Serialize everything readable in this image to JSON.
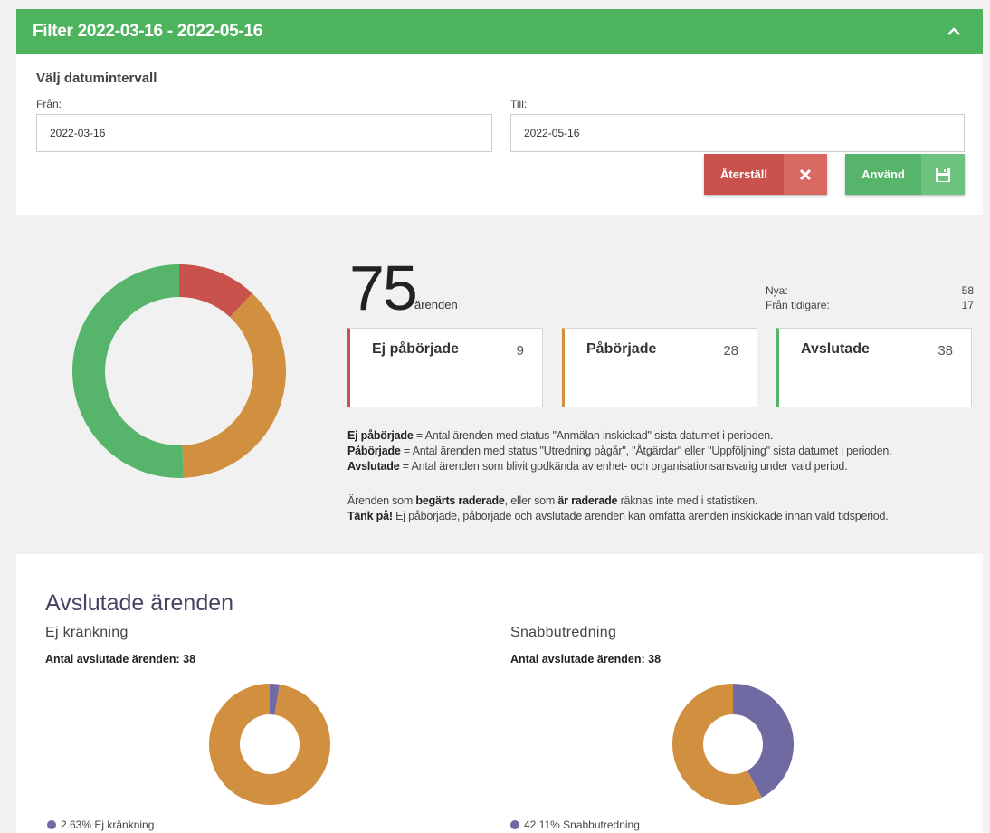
{
  "filter": {
    "title": "Filter 2022-03-16 - 2022-05-16",
    "collapse_icon": "chevron-up-icon",
    "section_label": "Välj datumintervall",
    "from_label": "Från:",
    "from_value": "2022-03-16",
    "to_label": "Till:",
    "to_value": "2022-05-16",
    "reset_label": "Återställ",
    "reset_icon": "close-icon",
    "apply_label": "Använd",
    "apply_icon": "save-icon",
    "header_color": "#4db35f"
  },
  "overview": {
    "total": "75",
    "total_unit": "ärenden",
    "new_label": "Nya:",
    "new_value": "58",
    "previous_label": "Från tidigare:",
    "previous_value": "17",
    "cards": [
      {
        "label": "Ej påbörjade",
        "value": "9",
        "color": "#c9524c"
      },
      {
        "label": "Påbörjade",
        "value": "28",
        "color": "#d1903f"
      },
      {
        "label": "Avslutade",
        "value": "38",
        "color": "#56b56a"
      }
    ],
    "legend": {
      "line1_bold": "Ej påbörjade",
      "line1_rest": " = Antal ärenden med status \"Anmälan inskickad\" sista datumet i perioden.",
      "line2_bold": "Påbörjade",
      "line2_rest": " = Antal ärenden med status \"Utredning pågår\", \"Åtgärdar\" eller \"Uppföljning\" sista datumet i perioden.",
      "line3_bold": "Avslutade",
      "line3_rest": " = Antal ärenden som blivit godkända av enhet- och organisationsansvarig under vald period.",
      "note1_a": "Ärenden som ",
      "note1_b": "begärts raderade",
      "note1_c": ", eller som ",
      "note1_d": "är raderade",
      "note1_e": " räknas inte med i statistiken.",
      "note2_bold": "Tänk på!",
      "note2_rest": " Ej påbörjade, påbörjade och avslutade ärenden kan omfatta ärenden inskickade innan vald tidsperiod."
    }
  },
  "closed": {
    "title": "Avslutade ärenden",
    "charts": [
      {
        "subtitle": "Ej kränkning",
        "count_text": "Antal avslutade ärenden: 38",
        "legend_text": "2.63% Ej kränkning"
      },
      {
        "subtitle": "Snabbutredning",
        "count_text": "Antal avslutade ärenden: 38",
        "legend_text": "42.11% Snabbutredning"
      }
    ]
  },
  "chart_data": [
    {
      "type": "pie",
      "categories": [
        "Ej påbörjade",
        "Påbörjade",
        "Avslutade"
      ],
      "values": [
        9,
        28,
        38
      ],
      "colors": [
        "#c9524c",
        "#d1903f",
        "#56b56a"
      ]
    },
    {
      "type": "pie",
      "title": "Ej kränkning",
      "categories": [
        "Ej kränkning",
        ""
      ],
      "values": [
        2.63,
        97.37
      ],
      "colors": [
        "#6f6aa1",
        "#d1903f"
      ]
    },
    {
      "type": "pie",
      "title": "Snabbutredning",
      "categories": [
        "Snabbutredning",
        ""
      ],
      "values": [
        42.11,
        57.89
      ],
      "colors": [
        "#6f6aa1",
        "#d1903f"
      ]
    }
  ]
}
